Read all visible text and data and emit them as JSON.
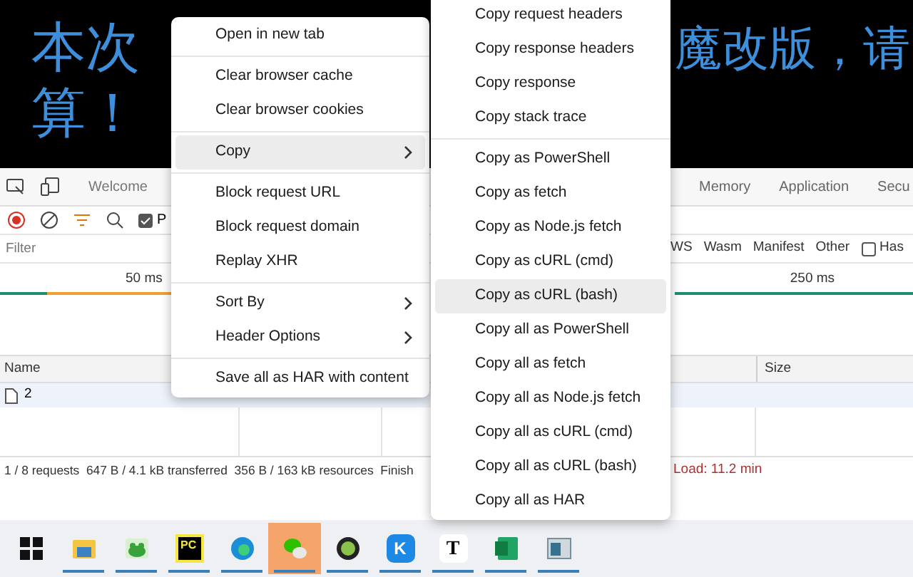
{
  "banner": {
    "lines": [
      {
        "left": "本次",
        "right": "魔改版，请"
      },
      {
        "left": "算！"
      }
    ]
  },
  "devtools": {
    "left_tabs": [
      {
        "label": "Welcome",
        "selected": false
      }
    ],
    "right_tabs": [
      {
        "label": "Memory",
        "selected": false
      },
      {
        "label": "Application",
        "selected": false
      },
      {
        "label": "Secu",
        "selected": false
      }
    ],
    "preserve_log": {
      "label": "P",
      "checked": true
    },
    "filter": {
      "placeholder": "Filter"
    },
    "type_filters": [
      "WS",
      "Wasm",
      "Manifest",
      "Other"
    ],
    "has_blocked": {
      "label": "Has",
      "checked": false
    },
    "ticks": [
      "50 ms",
      "250 ms"
    ],
    "columns": [
      "Name",
      "Size"
    ],
    "rows": [
      {
        "name": "2"
      }
    ],
    "status": {
      "summary": "1 / 8 requests  647 B / 4.1 kB transferred  356 B / 163 kB resources  Finish",
      "load": "Load: 11.2 min"
    }
  },
  "context_menu": {
    "groups": [
      [
        {
          "label": "Open in new tab",
          "submenu": false,
          "selected": false
        }
      ],
      [
        {
          "label": "Clear browser cache",
          "submenu": false,
          "selected": false
        },
        {
          "label": "Clear browser cookies",
          "submenu": false,
          "selected": false
        }
      ],
      [
        {
          "label": "Copy",
          "submenu": true,
          "selected": true
        }
      ],
      [
        {
          "label": "Block request URL",
          "submenu": false,
          "selected": false
        },
        {
          "label": "Block request domain",
          "submenu": false,
          "selected": false
        },
        {
          "label": "Replay XHR",
          "submenu": false,
          "selected": false
        }
      ],
      [
        {
          "label": "Sort By",
          "submenu": true,
          "selected": false
        },
        {
          "label": "Header Options",
          "submenu": true,
          "selected": false
        }
      ],
      [
        {
          "label": "Save all as HAR with content",
          "submenu": false,
          "selected": false
        }
      ]
    ]
  },
  "copy_submenu": {
    "groups": [
      [
        {
          "label": "Copy request headers",
          "selected": false
        },
        {
          "label": "Copy response headers",
          "selected": false
        },
        {
          "label": "Copy response",
          "selected": false
        },
        {
          "label": "Copy stack trace",
          "selected": false
        }
      ],
      [
        {
          "label": "Copy as PowerShell",
          "selected": false
        },
        {
          "label": "Copy as fetch",
          "selected": false
        },
        {
          "label": "Copy as Node.js fetch",
          "selected": false
        },
        {
          "label": "Copy as cURL (cmd)",
          "selected": false
        },
        {
          "label": "Copy as cURL (bash)",
          "selected": true
        },
        {
          "label": "Copy all as PowerShell",
          "selected": false
        },
        {
          "label": "Copy all as fetch",
          "selected": false
        },
        {
          "label": "Copy all as Node.js fetch",
          "selected": false
        },
        {
          "label": "Copy all as cURL (cmd)",
          "selected": false
        },
        {
          "label": "Copy all as cURL (bash)",
          "selected": false
        },
        {
          "label": "Copy all as HAR",
          "selected": false
        }
      ]
    ]
  },
  "taskbar": {
    "items": [
      {
        "kind": "windows",
        "selected": false,
        "running": false
      },
      {
        "kind": "folder",
        "selected": false,
        "running": true
      },
      {
        "kind": "frog",
        "selected": false,
        "running": true
      },
      {
        "kind": "ide",
        "glyph": "PC",
        "selected": false,
        "running": true
      },
      {
        "kind": "edge",
        "selected": false,
        "running": true
      },
      {
        "kind": "chat",
        "selected": true,
        "running": true
      },
      {
        "kind": "android",
        "selected": false,
        "running": true
      },
      {
        "kind": "letter",
        "glyph": "K",
        "selected": false,
        "running": true
      },
      {
        "kind": "editor",
        "glyph": "T",
        "selected": false,
        "running": true
      },
      {
        "kind": "sheet",
        "selected": false,
        "running": true
      },
      {
        "kind": "window",
        "selected": false,
        "running": true
      }
    ]
  }
}
